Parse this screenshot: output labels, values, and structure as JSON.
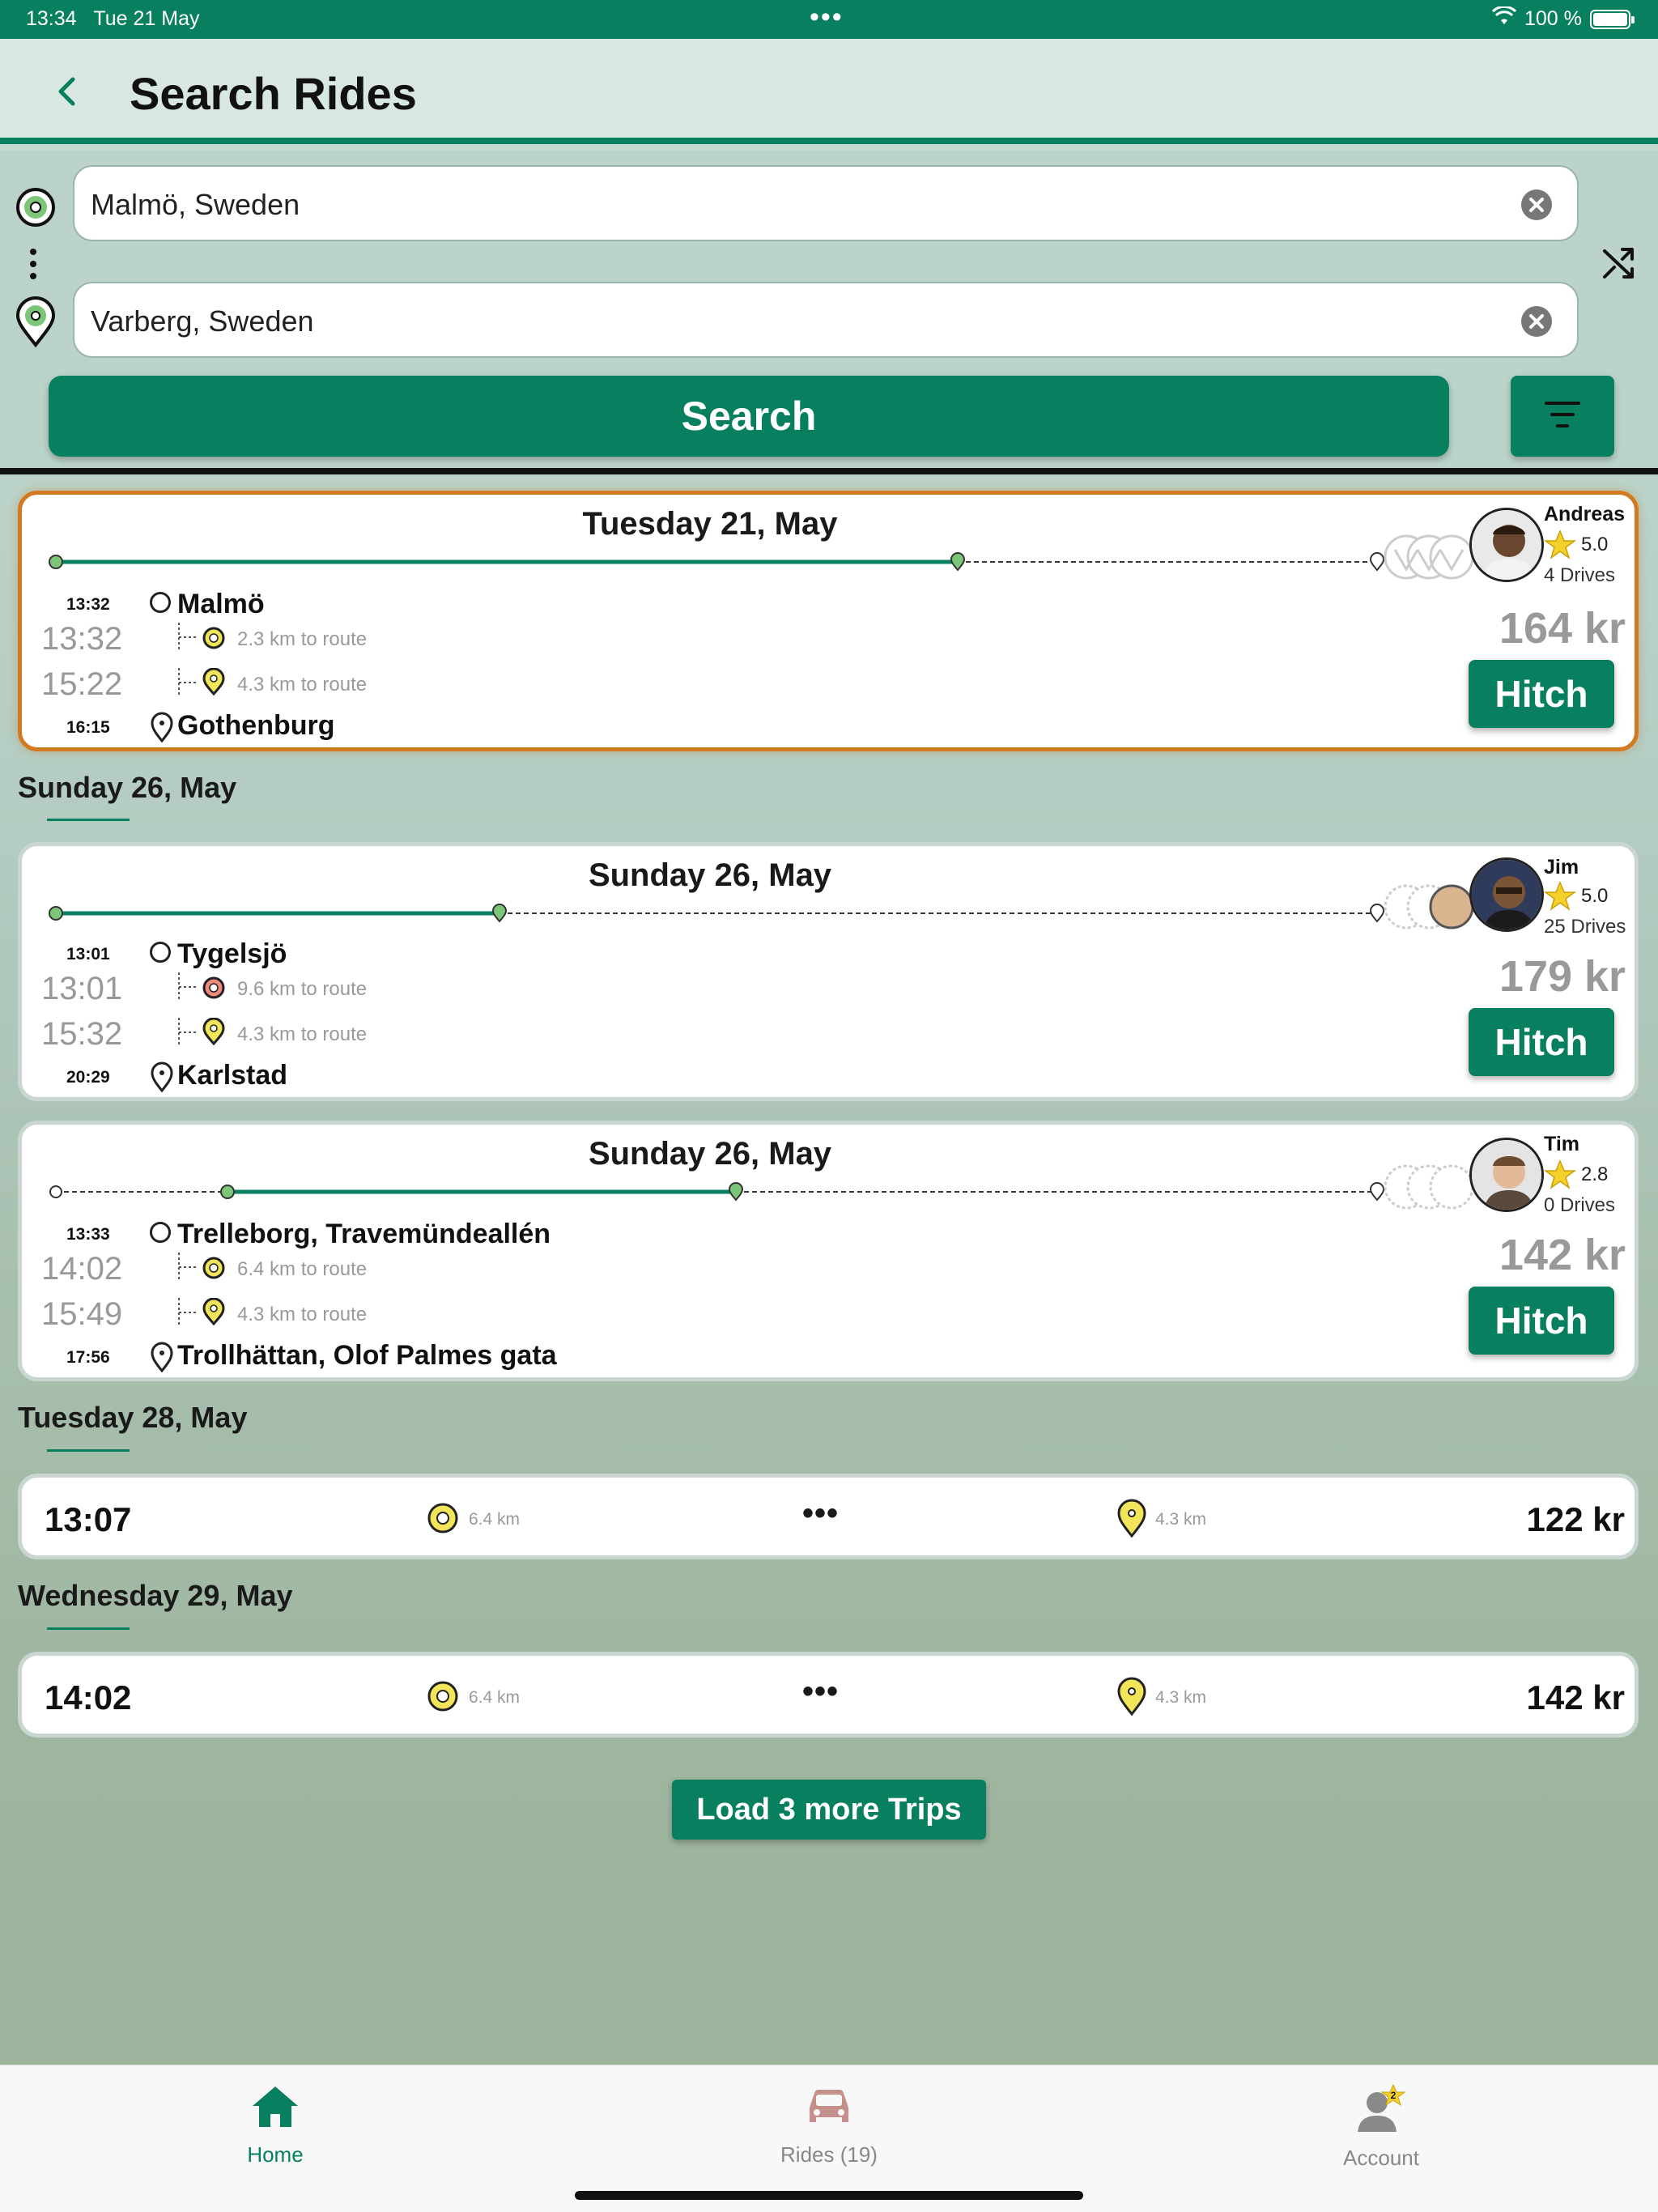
{
  "status_bar": {
    "time": "13:34",
    "date": "Tue 21 May",
    "battery": "100 %"
  },
  "header": {
    "title": "Search Rides"
  },
  "search": {
    "origin": "Malmö, Sweden",
    "destination": "Varberg, Sweden",
    "button_label": "Search"
  },
  "featured_sections": [
    {
      "date": "Tuesday 21, May",
      "highlighted": true,
      "depart_time": "13:32",
      "origin": "Malmö",
      "pickup_time": "13:32",
      "pickup_km": "2.3 km to route",
      "dropoff_time": "15:22",
      "dropoff_km": "4.3 km to route",
      "arrive_time": "16:15",
      "destination": "Gothenburg",
      "driver": "Andreas",
      "rating": "5.0",
      "drives": "4 Drives",
      "price": "164 kr",
      "hitch_label": "Hitch"
    }
  ],
  "groups": [
    {
      "label": "Sunday 26, May",
      "cards": [
        {
          "date": "Sunday 26, May",
          "depart_time": "13:01",
          "origin": "Tygelsjö",
          "pickup_time": "13:01",
          "pickup_km": "9.6 km to route",
          "dropoff_time": "15:32",
          "dropoff_km": "4.3 km to route",
          "arrive_time": "20:29",
          "destination": "Karlstad",
          "driver": "Jim",
          "rating": "5.0",
          "drives": "25 Drives",
          "price": "179 kr",
          "hitch_label": "Hitch"
        },
        {
          "date": "Sunday 26, May",
          "depart_time": "13:33",
          "origin": "Trelleborg, Travemündeallén",
          "pickup_time": "14:02",
          "pickup_km": "6.4 km to route",
          "dropoff_time": "15:49",
          "dropoff_km": "4.3 km to route",
          "arrive_time": "17:56",
          "destination": "Trollhättan, Olof Palmes gata",
          "driver": "Tim",
          "rating": "2.8",
          "drives": "0 Drives",
          "price": "142 kr",
          "hitch_label": "Hitch"
        }
      ]
    },
    {
      "label": "Tuesday 28, May",
      "compact": {
        "time": "13:07",
        "pickup_km": "6.4 km",
        "dropoff_km": "4.3 km",
        "price": "122 kr"
      }
    },
    {
      "label": "Wednesday 29, May",
      "compact": {
        "time": "14:02",
        "pickup_km": "6.4 km",
        "dropoff_km": "4.3 km",
        "price": "142 kr"
      }
    }
  ],
  "load_more_label": "Load 3 more Trips",
  "tabs": [
    {
      "label": "Home",
      "icon": "home-icon",
      "active": true
    },
    {
      "label": "Rides (19)",
      "icon": "car-icon",
      "active": false
    },
    {
      "label": "Account",
      "icon": "account-icon",
      "active": false,
      "badge": "2"
    }
  ],
  "colors": {
    "brand": "#08805f",
    "highlight_border": "#d17a22"
  }
}
